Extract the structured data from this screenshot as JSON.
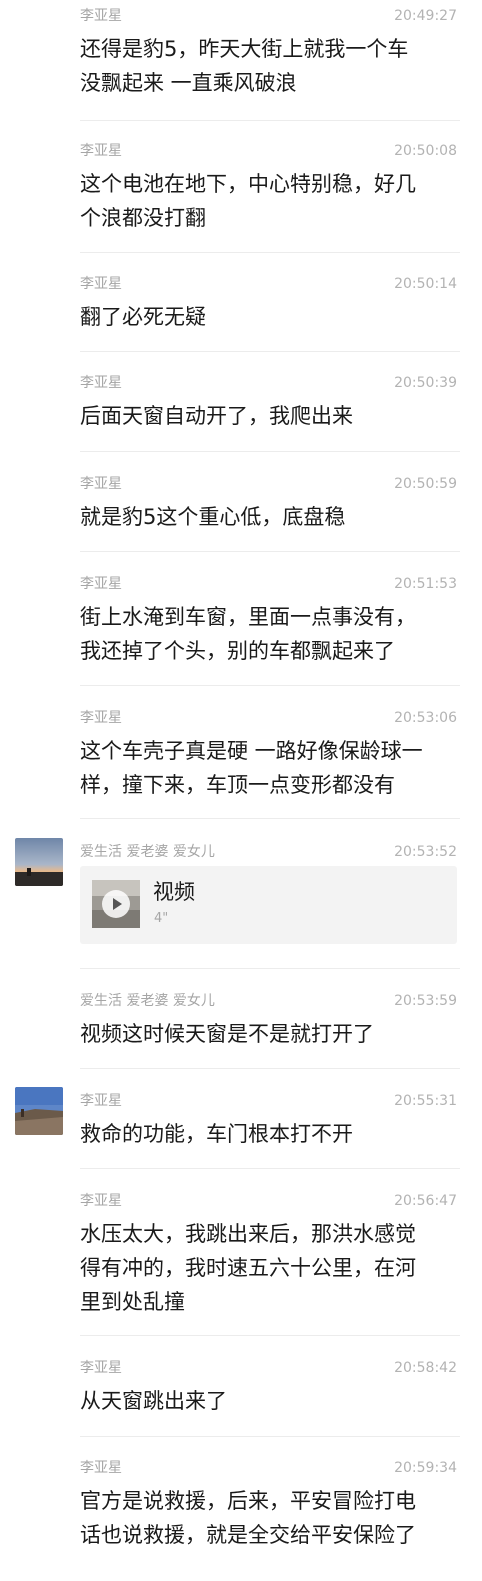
{
  "messages": [
    {
      "sender": "李亚星",
      "time": "20:49:27",
      "text": "还得是豹5，昨天大街上就我一个车\n没飘起来  一直乘风破浪"
    },
    {
      "sender": "李亚星",
      "time": "20:50:08",
      "text": "这个电池在地下，中心特别稳，好几\n个浪都没打翻"
    },
    {
      "sender": "李亚星",
      "time": "20:50:14",
      "text": "翻了必死无疑"
    },
    {
      "sender": "李亚星",
      "time": "20:50:39",
      "text": "后面天窗自动开了，我爬出来"
    },
    {
      "sender": "李亚星",
      "time": "20:50:59",
      "text": "就是豹5这个重心低，底盘稳"
    },
    {
      "sender": "李亚星",
      "time": "20:51:53",
      "text": "街上水淹到车窗，里面一点事没有，\n我还掉了个头，别的车都飘起来了"
    },
    {
      "sender": "李亚星",
      "time": "20:53:06",
      "text": "这个车壳子真是硬 一路好像保龄球一\n样，撞下来，车顶一点变形都没有"
    },
    {
      "sender": "爱生活 爱老婆  爱女儿",
      "time": "20:53:52",
      "video": {
        "title": "视频",
        "duration": "4\""
      }
    },
    {
      "sender": "爱生活 爱老婆  爱女儿",
      "time": "20:53:59",
      "text": "视频这时候天窗是不是就打开了"
    },
    {
      "sender": "李亚星",
      "time": "20:55:31",
      "text": "救命的功能，车门根本打不开"
    },
    {
      "sender": "李亚星",
      "time": "20:56:47",
      "text": "水压太大，我跳出来后，那洪水感觉\n得有冲的，我时速五六十公里，在河\n里到处乱撞"
    },
    {
      "sender": "李亚星",
      "time": "20:58:42",
      "text": "从天窗跳出来了"
    },
    {
      "sender": "李亚星",
      "time": "20:59:34",
      "text": "官方是说救援，后来，平安冒险打电\n话也说救援，就是全交给平安保险了"
    }
  ]
}
